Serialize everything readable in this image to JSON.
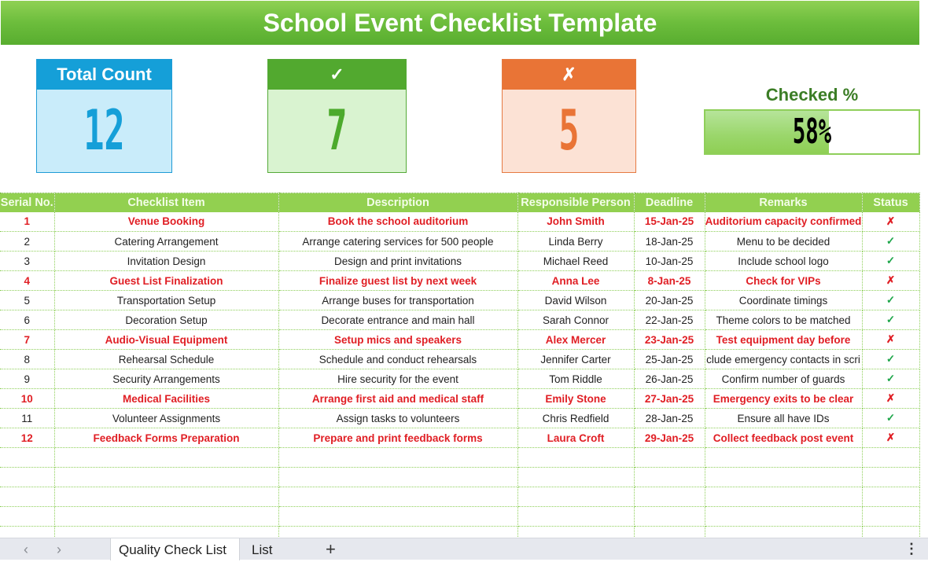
{
  "title": "School Event Checklist Template",
  "kpis": {
    "total": {
      "label": "Total Count",
      "value": "12"
    },
    "checked": {
      "label": "✓",
      "value": "7"
    },
    "unchecked": {
      "label": "✗",
      "value": "5"
    }
  },
  "progress": {
    "label": "Checked %",
    "value_text": "58%",
    "fraction": 0.58
  },
  "colors": {
    "accent_green": "#92d050",
    "total_blue": "#159fd8",
    "checked_green": "#52a92f",
    "unchecked_orange": "#e97436",
    "flag_red": "#e01e24",
    "check_green": "#1ea64a"
  },
  "table": {
    "headers": [
      "Serial No.",
      "Checklist Item",
      "Description",
      "Responsible Person",
      "Deadline",
      "Remarks",
      "Status"
    ],
    "rows": [
      {
        "serial": "1",
        "item": "Venue Booking",
        "description": "Book the school auditorium",
        "person": "John Smith",
        "deadline": "15-Jan-25",
        "remarks": "Auditorium capacity confirmed",
        "status": "✗",
        "checked": false
      },
      {
        "serial": "2",
        "item": "Catering Arrangement",
        "description": "Arrange catering services for 500 people",
        "person": "Linda Berry",
        "deadline": "18-Jan-25",
        "remarks": "Menu to be decided",
        "status": "✓",
        "checked": true
      },
      {
        "serial": "3",
        "item": "Invitation Design",
        "description": "Design and print invitations",
        "person": "Michael Reed",
        "deadline": "10-Jan-25",
        "remarks": "Include school logo",
        "status": "✓",
        "checked": true
      },
      {
        "serial": "4",
        "item": "Guest List Finalization",
        "description": "Finalize guest list by next week",
        "person": "Anna Lee",
        "deadline": "8-Jan-25",
        "remarks": "Check for VIPs",
        "status": "✗",
        "checked": false
      },
      {
        "serial": "5",
        "item": "Transportation Setup",
        "description": "Arrange buses for transportation",
        "person": "David Wilson",
        "deadline": "20-Jan-25",
        "remarks": "Coordinate timings",
        "status": "✓",
        "checked": true
      },
      {
        "serial": "6",
        "item": "Decoration Setup",
        "description": "Decorate entrance and main hall",
        "person": "Sarah Connor",
        "deadline": "22-Jan-25",
        "remarks": "Theme colors to be matched",
        "status": "✓",
        "checked": true
      },
      {
        "serial": "7",
        "item": "Audio-Visual Equipment",
        "description": "Setup mics and speakers",
        "person": "Alex Mercer",
        "deadline": "23-Jan-25",
        "remarks": "Test equipment day before",
        "status": "✗",
        "checked": false
      },
      {
        "serial": "8",
        "item": "Rehearsal Schedule",
        "description": "Schedule and conduct rehearsals",
        "person": "Jennifer Carter",
        "deadline": "25-Jan-25",
        "remarks": "clude emergency contacts in scri",
        "status": "✓",
        "checked": true
      },
      {
        "serial": "9",
        "item": "Security Arrangements",
        "description": "Hire security for the event",
        "person": "Tom Riddle",
        "deadline": "26-Jan-25",
        "remarks": "Confirm number of guards",
        "status": "✓",
        "checked": true
      },
      {
        "serial": "10",
        "item": "Medical Facilities",
        "description": "Arrange first aid and medical staff",
        "person": "Emily Stone",
        "deadline": "27-Jan-25",
        "remarks": "Emergency exits to be clear",
        "status": "✗",
        "checked": false
      },
      {
        "serial": "11",
        "item": "Volunteer Assignments",
        "description": "Assign tasks to volunteers",
        "person": "Chris Redfield",
        "deadline": "28-Jan-25",
        "remarks": "Ensure all have IDs",
        "status": "✓",
        "checked": true
      },
      {
        "serial": "12",
        "item": "Feedback Forms Preparation",
        "description": "Prepare and print feedback forms",
        "person": "Laura Croft",
        "deadline": "29-Jan-25",
        "remarks": "Collect feedback post event",
        "status": "✗",
        "checked": false
      }
    ],
    "empty_rows": 5
  },
  "sheet_tabs": {
    "tabs": [
      {
        "label": "Quality Check List",
        "active": true
      },
      {
        "label": "List",
        "active": false
      }
    ],
    "prev": "‹",
    "next": "›",
    "add": "+",
    "more": "⋮"
  }
}
